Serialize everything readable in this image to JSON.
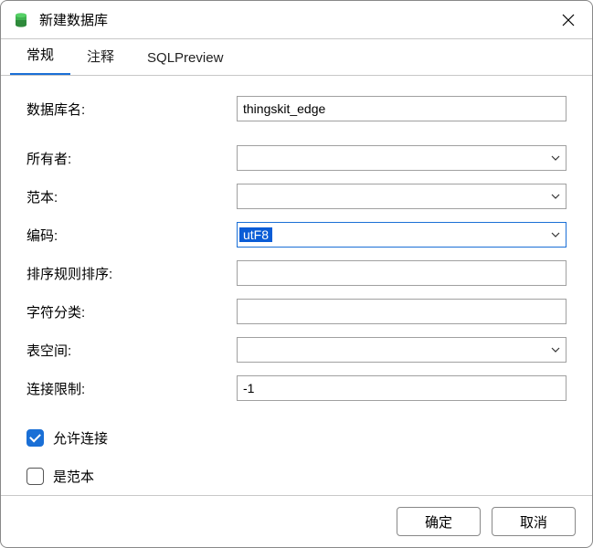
{
  "window": {
    "title": "新建数据库"
  },
  "tabs": {
    "general": "常规",
    "comment": "注释",
    "sqlpreview": "SQLPreview"
  },
  "form": {
    "db_name_label": "数据库名:",
    "db_name_value": "thingskit_edge",
    "owner_label": "所有者:",
    "owner_value": "",
    "template_label": "范本:",
    "template_value": "",
    "encoding_label": "编码:",
    "encoding_value": "utF8",
    "collation_label": "排序规则排序:",
    "collation_value": "",
    "ctype_label": "字符分类:",
    "ctype_value": "",
    "tablespace_label": "表空间:",
    "tablespace_value": "",
    "conn_limit_label": "连接限制:",
    "conn_limit_value": "-1",
    "allow_conn_label": "允许连接",
    "allow_conn_checked": true,
    "is_template_label": "是范本",
    "is_template_checked": false
  },
  "buttons": {
    "ok": "确定",
    "cancel": "取消"
  }
}
